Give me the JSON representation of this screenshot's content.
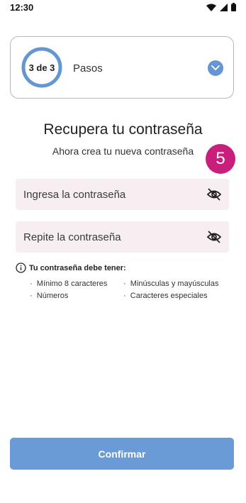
{
  "status_bar": {
    "time": "12:30"
  },
  "steps": {
    "count_label": "3 de 3",
    "label": "Pasos"
  },
  "title": "Recupera tu contraseña",
  "subtitle": "Ahora crea tu nueva contraseña",
  "step_badge": "5",
  "fields": {
    "password_placeholder": "Ingresa la contraseña",
    "confirm_placeholder": "Repite la contraseña"
  },
  "requirements": {
    "title": "Tu contraseña debe tener:",
    "items": [
      "Mínimo 8 caracteres",
      "Minúsculas y mayúsculas",
      "Números",
      "Caracteres especiales"
    ]
  },
  "confirm_label": "Confirmar",
  "colors": {
    "accent": "#6a9bd6",
    "badge": "#c81f7d",
    "field_bg": "#f7eef2"
  }
}
